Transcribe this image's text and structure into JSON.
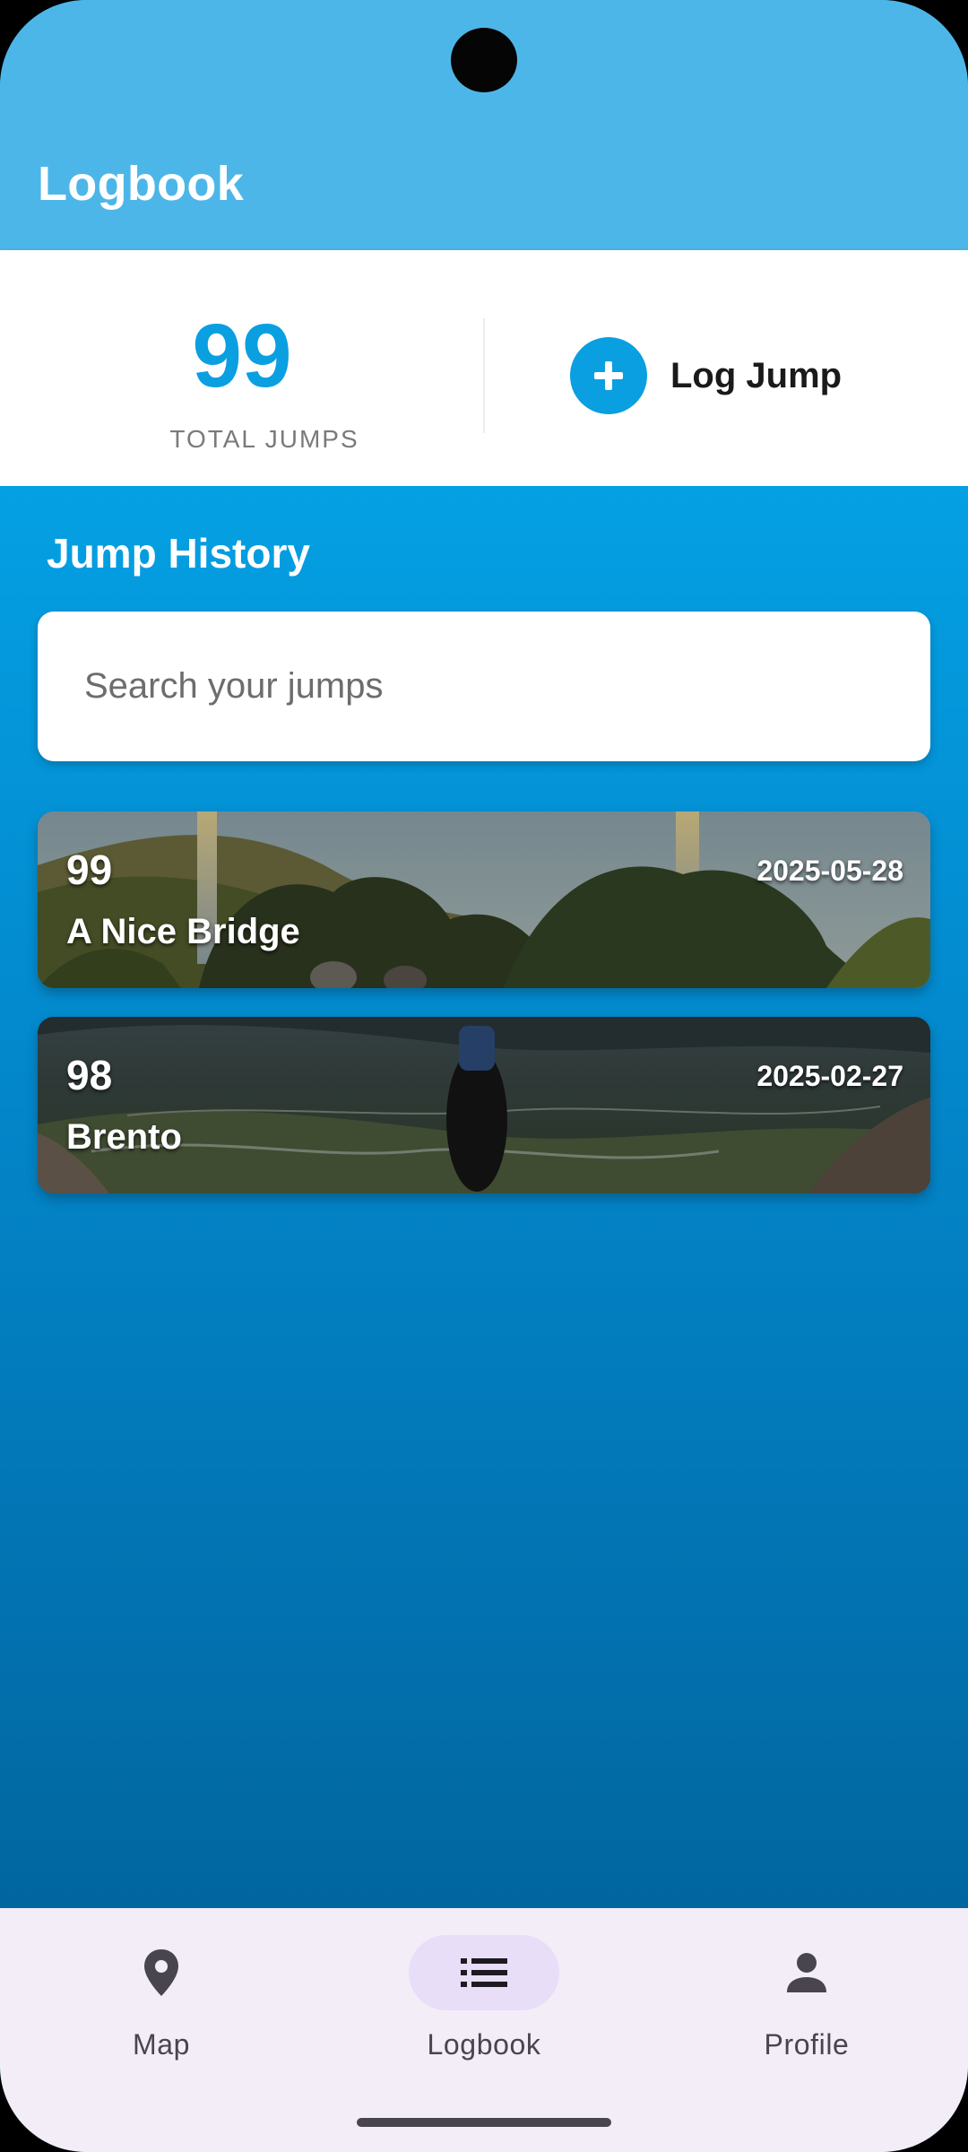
{
  "appbar": {
    "title": "Logbook"
  },
  "stats": {
    "total_jumps": "99",
    "total_label": "TOTAL JUMPS",
    "log_jump_label": "Log Jump"
  },
  "history": {
    "title": "Jump History",
    "search_placeholder": "Search your jumps",
    "jumps": [
      {
        "number": "99",
        "name": "A Nice Bridge",
        "date": "2025-05-28"
      },
      {
        "number": "98",
        "name": "Brento",
        "date": "2025-02-27"
      }
    ]
  },
  "nav": {
    "items": [
      {
        "label": "Map",
        "icon": "map-pin-icon"
      },
      {
        "label": "Logbook",
        "icon": "list-icon",
        "active": true
      },
      {
        "label": "Profile",
        "icon": "person-icon"
      }
    ]
  },
  "colors": {
    "appbar": "#4db6e8",
    "accent": "#0a9fe0",
    "nav_background": "#f3edf7",
    "nav_active_pill": "#e8def8"
  }
}
